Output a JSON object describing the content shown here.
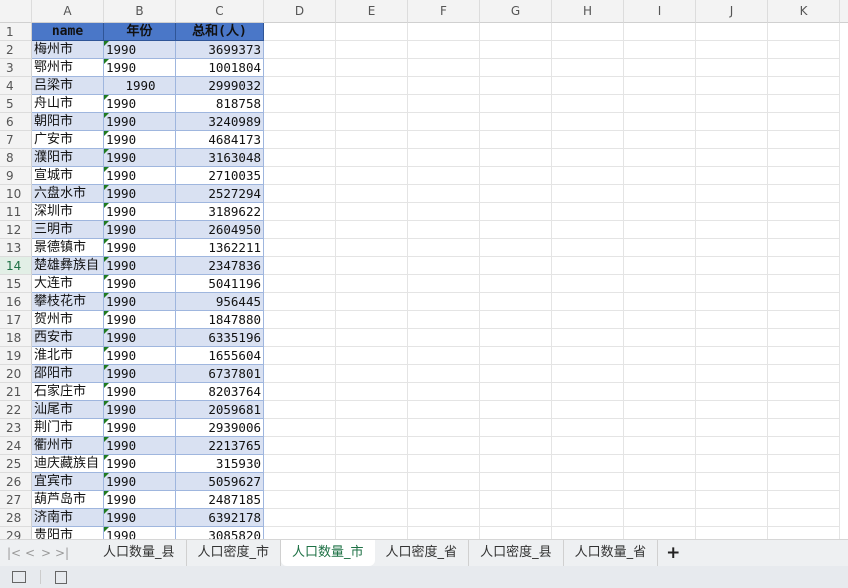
{
  "columns": [
    "A",
    "B",
    "C",
    "D",
    "E",
    "F",
    "G",
    "H",
    "I",
    "J",
    "K"
  ],
  "header": {
    "name": "name",
    "year": "年份",
    "total": "总和(人)"
  },
  "rows": [
    [
      "梅州市",
      "1990",
      "3699373"
    ],
    [
      "鄂州市",
      "1990",
      "1001804"
    ],
    [
      "吕梁市",
      "1990",
      "2999032"
    ],
    [
      "舟山市",
      "1990",
      "818758"
    ],
    [
      "朝阳市",
      "1990",
      "3240989"
    ],
    [
      "广安市",
      "1990",
      "4684173"
    ],
    [
      "濮阳市",
      "1990",
      "3163048"
    ],
    [
      "宣城市",
      "1990",
      "2710035"
    ],
    [
      "六盘水市",
      "1990",
      "2527294"
    ],
    [
      "深圳市",
      "1990",
      "3189622"
    ],
    [
      "三明市",
      "1990",
      "2604950"
    ],
    [
      "景德镇市",
      "1990",
      "1362211"
    ],
    [
      "楚雄彝族自",
      "1990",
      "2347836"
    ],
    [
      "大连市",
      "1990",
      "5041196"
    ],
    [
      "攀枝花市",
      "1990",
      "956445"
    ],
    [
      "贺州市",
      "1990",
      "1847880"
    ],
    [
      "西安市",
      "1990",
      "6335196"
    ],
    [
      "淮北市",
      "1990",
      "1655604"
    ],
    [
      "邵阳市",
      "1990",
      "6737801"
    ],
    [
      "石家庄市",
      "1990",
      "8203764"
    ],
    [
      "汕尾市",
      "1990",
      "2059681"
    ],
    [
      "荆门市",
      "1990",
      "2939006"
    ],
    [
      "衢州市",
      "1990",
      "2213765"
    ],
    [
      "迪庆藏族自",
      "1990",
      "315930"
    ],
    [
      "宜宾市",
      "1990",
      "5059627"
    ],
    [
      "葫芦岛市",
      "1990",
      "2487185"
    ],
    [
      "济南市",
      "1990",
      "6392178"
    ],
    [
      "贵阳市",
      "1990",
      "3085820"
    ]
  ],
  "sheet_tabs": [
    "人口数量_县",
    "人口密度_市",
    "人口数量_市",
    "人口密度_省",
    "人口密度_县",
    "人口数量_省"
  ],
  "active_tab": 2,
  "nav": {
    "first": "|<",
    "prev": "<",
    "next": ">",
    "last": ">|",
    "add": "+"
  },
  "selected_row": 14
}
